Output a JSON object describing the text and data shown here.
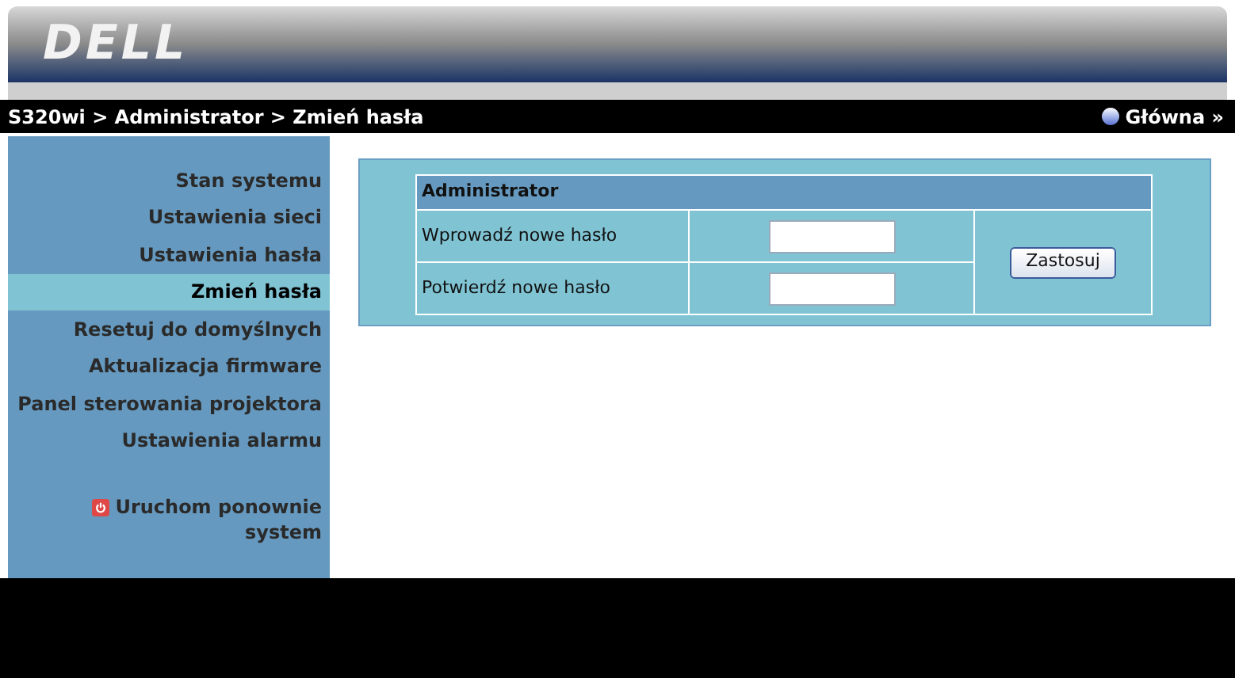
{
  "header": {
    "logo": "DELL"
  },
  "breadcrumb": {
    "text": "S320wi > Administrator > Zmień hasła",
    "home_link": "Główna »"
  },
  "sidebar": {
    "items": [
      {
        "label": "Stan systemu",
        "selected": false
      },
      {
        "label": "Ustawienia sieci",
        "selected": false
      },
      {
        "label": "Ustawienia hasła",
        "selected": false
      },
      {
        "label": "Zmień hasła",
        "selected": true
      },
      {
        "label": "Resetuj do domyślnych",
        "selected": false
      },
      {
        "label": "Aktualizacja firmware",
        "selected": false
      },
      {
        "label": "Panel sterowania projektora",
        "selected": false
      },
      {
        "label": "Ustawienia alarmu",
        "selected": false
      }
    ],
    "restart": {
      "line1": "Uruchom ponownie",
      "line2": "system"
    }
  },
  "form": {
    "title": "Administrator",
    "fields": [
      {
        "label": "Wprowadź nowe hasło"
      },
      {
        "label": "Potwierdź nowe hasło"
      }
    ],
    "button": "Zastosuj"
  }
}
